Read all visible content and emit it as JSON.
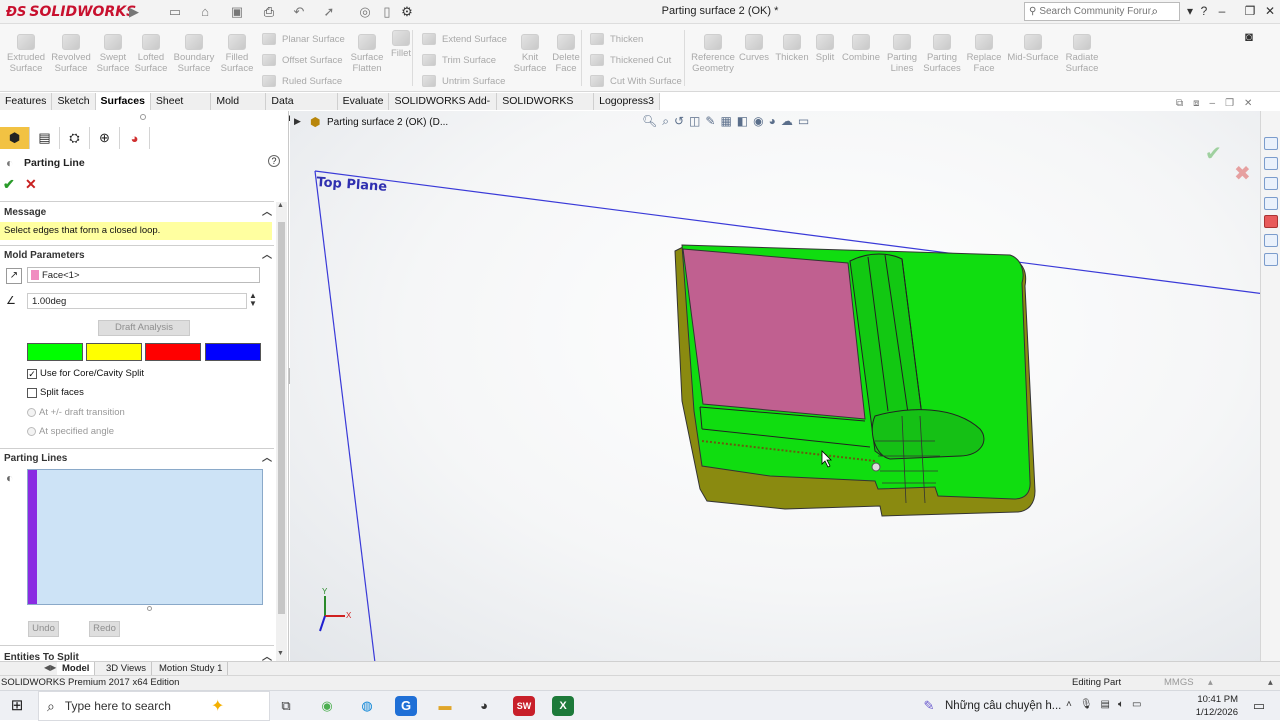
{
  "app": {
    "logo_text": "SOLIDWORKS",
    "window_title": "Parting surface 2 (OK) *"
  },
  "search": {
    "placeholder": "Search Community Forum"
  },
  "toolbar": {
    "big_tools": [
      "Extruded Surface",
      "Revolved Surface",
      "Swept Surface",
      "Lofted Surface",
      "Boundary Surface",
      "Filled Surface"
    ],
    "col1": [
      "Planar Surface",
      "Offset Surface",
      "Ruled Surface"
    ],
    "mid_tools": [
      "Surface Flatten",
      "Fillet"
    ],
    "col2": [
      "Extend Surface",
      "Trim Surface",
      "Untrim Surface"
    ],
    "mid2_tools": [
      "Knit Surface",
      "Delete Face"
    ],
    "col3": [
      "Thicken",
      "Thickened Cut",
      "Cut With Surface"
    ],
    "right_tools": [
      "Reference Geometry",
      "Curves",
      "Thicken",
      "Split",
      "Combine",
      "Parting Lines",
      "Parting Surfaces",
      "Replace Face",
      "Mid-Surface",
      "Radiate Surface"
    ]
  },
  "tabs": [
    "Features",
    "Sketch",
    "Surfaces",
    "Sheet Metal",
    "Mold Tools",
    "Data Migration",
    "Evaluate",
    "SOLIDWORKS Add-Ins",
    "SOLIDWORKS MBD",
    "Logopress3"
  ],
  "active_tab": "Surfaces",
  "tree": {
    "item": "Parting surface 2 (OK)  (D..."
  },
  "panel": {
    "title": "Parting Line",
    "message_head": "Message",
    "message": "Select edges that form a closed loop.",
    "mold_head": "Mold Parameters",
    "direction_value": "Face<1>",
    "angle_value": "1.00deg",
    "draft_btn": "Draft Analysis",
    "colors": [
      "#00ff00",
      "#ffff00",
      "#ff0000",
      "#0000ff"
    ],
    "use_core": "Use for Core/Cavity Split",
    "split_faces": "Split faces",
    "draft_transition": "At +/- draft transition",
    "specified_angle": "At specified angle",
    "parting_head": "Parting Lines",
    "undo": "Undo",
    "redo": "Redo",
    "entities_head": "Entities To Split"
  },
  "viewport": {
    "plane_label": "Top Plane",
    "axis_x": "X",
    "axis_y": "Y"
  },
  "bottom_tabs": [
    "Model",
    "3D Views",
    "Motion Study 1"
  ],
  "status": {
    "left": "SOLIDWORKS Premium 2017 x64 Edition",
    "mode": "Editing Part",
    "units": "MMGS"
  },
  "taskbar": {
    "search": "Type here to search",
    "news": "Những câu chuyện h...",
    "time": "10:41 PM",
    "date": "1/12/2026"
  }
}
